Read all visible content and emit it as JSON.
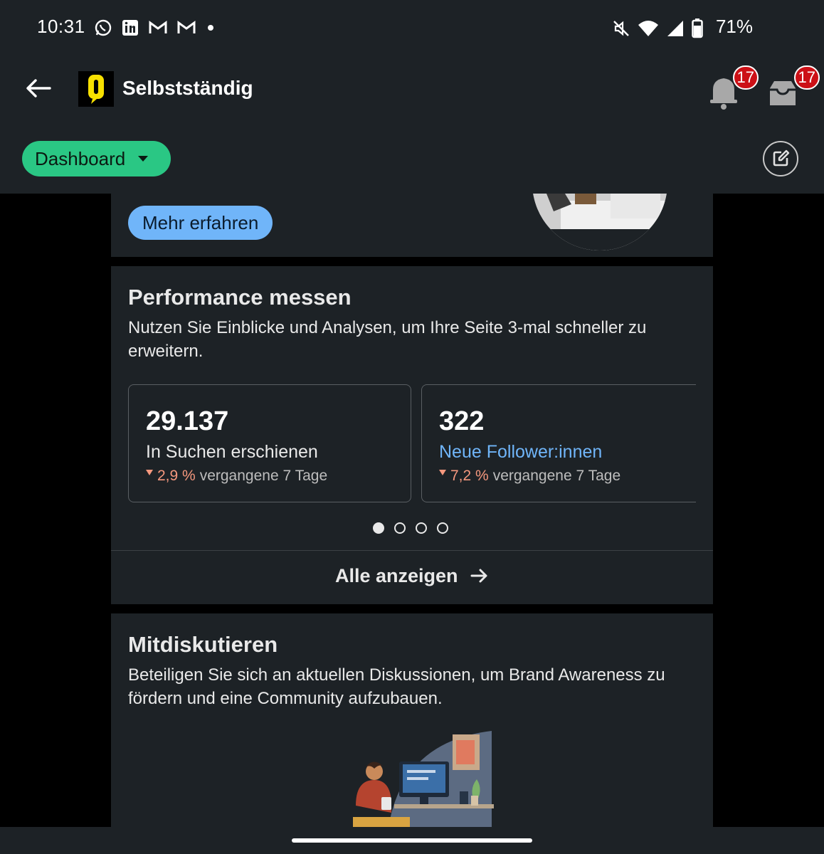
{
  "status_bar": {
    "time": "10:31",
    "battery": "71%",
    "left_icons": [
      "whatsapp-icon",
      "linkedin-icon",
      "gmail-icon",
      "gmail-icon",
      "dot-icon"
    ],
    "right_icons": [
      "mute-icon",
      "wifi-icon",
      "signal-icon",
      "battery-icon"
    ]
  },
  "header": {
    "title": "Selbstständig",
    "notifications_badge": "17",
    "inbox_badge": "17"
  },
  "toolbar": {
    "dashboard_label": "Dashboard"
  },
  "promo_card": {
    "button_label": "Mehr erfahren"
  },
  "performance": {
    "title": "Performance messen",
    "description": "Nutzen Sie Einblicke und Analysen, um Ihre Seite 3-mal schneller zu erweitern.",
    "metrics": [
      {
        "value": "29.137",
        "label": "In Suchen erschienen",
        "change": "2,9 %",
        "period": "vergangene 7 Tage"
      },
      {
        "value": "322",
        "label": "Neue Follower:innen",
        "change": "7,2 %",
        "period": "vergangene 7 Tage"
      }
    ],
    "see_all": "Alle anzeigen"
  },
  "discuss": {
    "title": "Mitdiskutieren",
    "description": "Beteiligen Sie sich an aktuellen Diskussionen, um Brand Awareness zu fördern und eine Community aufzubauen."
  },
  "colors": {
    "background": "#000000",
    "surface": "#1d2226",
    "accent_green": "#2ac784",
    "accent_blue": "#70b5f9",
    "badge_red": "#cc1016",
    "decrease": "#f5987e"
  }
}
